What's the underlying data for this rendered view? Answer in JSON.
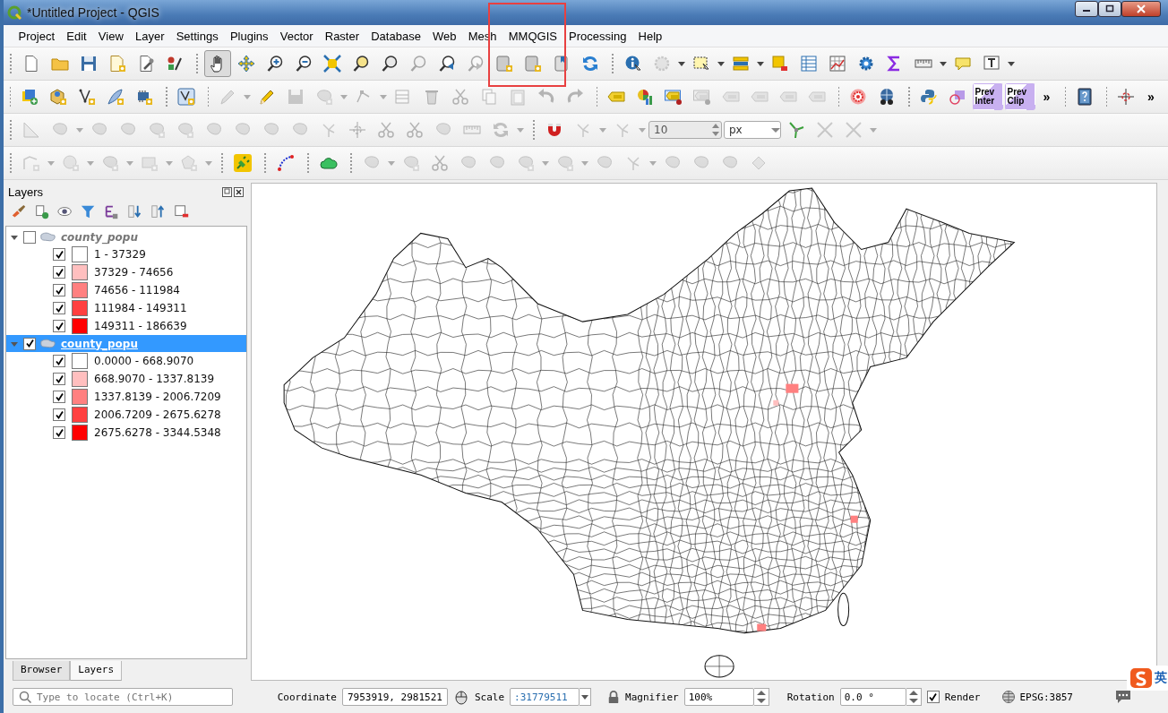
{
  "window": {
    "title": "*Untitled Project - QGIS"
  },
  "menu": [
    "Project",
    "Edit",
    "View",
    "Layer",
    "Settings",
    "Plugins",
    "Vector",
    "Raster",
    "Database",
    "Web",
    "Mesh",
    "MMQGIS",
    "Processing",
    "Help"
  ],
  "toolbars": [
    {
      "groups": [
        [
          {
            "kind": "new-project",
            "disabled": false,
            "selected": false
          },
          {
            "kind": "open-project",
            "disabled": false,
            "selected": false
          },
          {
            "kind": "save-project",
            "disabled": false,
            "selected": false
          },
          {
            "kind": "new-layout",
            "disabled": false,
            "selected": false
          },
          {
            "kind": "layout-manager",
            "disabled": false,
            "selected": false
          },
          {
            "kind": "style-manager",
            "disabled": false,
            "selected": false
          }
        ],
        [
          {
            "kind": "pan",
            "disabled": false,
            "selected": true
          },
          {
            "kind": "pan-to-selection",
            "disabled": false,
            "selected": false
          },
          {
            "kind": "zoom-in",
            "disabled": false,
            "selected": false
          },
          {
            "kind": "zoom-out",
            "disabled": false,
            "selected": false
          },
          {
            "kind": "zoom-full",
            "disabled": false,
            "selected": false
          },
          {
            "kind": "zoom-layer",
            "disabled": false,
            "selected": false
          },
          {
            "kind": "zoom-selection",
            "disabled": false,
            "selected": false
          },
          {
            "kind": "zoom-native",
            "disabled": true,
            "selected": false
          },
          {
            "kind": "zoom-last",
            "disabled": false,
            "selected": false
          },
          {
            "kind": "zoom-next",
            "disabled": true,
            "selected": false
          },
          {
            "kind": "map-sheet",
            "disabled": false,
            "selected": false
          },
          {
            "kind": "map-sheet",
            "disabled": false,
            "selected": false
          },
          {
            "kind": "bookmark",
            "disabled": false,
            "selected": false
          },
          {
            "kind": "refresh",
            "disabled": false,
            "selected": false
          }
        ],
        [
          {
            "kind": "identify",
            "disabled": false,
            "selected": false
          },
          {
            "kind": "pointer",
            "disabled": true,
            "selected": false
          },
          {
            "kind": "caret",
            "disabled": false,
            "selected": false
          },
          {
            "kind": "select",
            "disabled": false,
            "selected": false
          },
          {
            "kind": "caret",
            "disabled": false,
            "selected": false
          },
          {
            "kind": "select-value",
            "disabled": false,
            "selected": false
          },
          {
            "kind": "caret",
            "disabled": false,
            "selected": false
          },
          {
            "kind": "deselect",
            "disabled": false,
            "selected": false
          },
          {
            "kind": "attribute-table",
            "disabled": false,
            "selected": false
          },
          {
            "kind": "statistics",
            "disabled": false,
            "selected": false
          },
          {
            "kind": "toolbox",
            "disabled": false,
            "selected": false
          },
          {
            "kind": "sum",
            "disabled": false,
            "selected": false
          },
          {
            "kind": "measure",
            "disabled": false,
            "selected": false
          },
          {
            "kind": "caret",
            "disabled": false,
            "selected": false
          },
          {
            "kind": "map-tip",
            "disabled": false,
            "selected": false
          },
          {
            "kind": "text-annotation",
            "disabled": false,
            "selected": false
          },
          {
            "kind": "caret",
            "disabled": false,
            "selected": false
          }
        ]
      ]
    },
    {
      "groups": [
        [
          {
            "kind": "data-source",
            "disabled": false
          },
          {
            "kind": "new-geopackage",
            "disabled": false
          },
          {
            "kind": "new-shapefile",
            "disabled": false
          },
          {
            "kind": "new-temp",
            "disabled": false
          },
          {
            "kind": "virtual-layer",
            "disabled": false
          }
        ],
        [
          {
            "kind": "digitize-frame",
            "disabled": false
          }
        ],
        [
          {
            "kind": "current-edits",
            "disabled": true
          },
          {
            "kind": "caret",
            "disabled": true
          },
          {
            "kind": "toggle-edit",
            "disabled": false
          },
          {
            "kind": "save-edits",
            "disabled": true
          },
          {
            "kind": "shape-star",
            "disabled": true
          },
          {
            "kind": "caret",
            "disabled": true
          },
          {
            "kind": "vertex-tool",
            "disabled": true
          },
          {
            "kind": "caret",
            "disabled": true
          },
          {
            "kind": "modify-attributes",
            "disabled": true
          },
          {
            "kind": "delete",
            "disabled": true
          },
          {
            "kind": "cut",
            "disabled": true
          },
          {
            "kind": "copy",
            "disabled": true
          },
          {
            "kind": "paste",
            "disabled": true
          },
          {
            "kind": "undo",
            "disabled": true
          },
          {
            "kind": "redo",
            "disabled": true
          }
        ],
        [
          {
            "kind": "label",
            "disabled": false
          },
          {
            "kind": "diagram",
            "disabled": false
          },
          {
            "kind": "label-pin",
            "disabled": false
          },
          {
            "kind": "label-pin",
            "disabled": true
          },
          {
            "kind": "label",
            "disabled": true
          },
          {
            "kind": "label",
            "disabled": true
          },
          {
            "kind": "label",
            "disabled": true
          },
          {
            "kind": "label",
            "disabled": true
          }
        ],
        [
          {
            "kind": "target",
            "disabled": false
          },
          {
            "kind": "globe",
            "disabled": false
          }
        ],
        [
          {
            "kind": "python",
            "disabled": false
          },
          {
            "kind": "square-circle",
            "disabled": false
          },
          {
            "kind": "prev",
            "label": "Prev Inter",
            "disabled": false
          },
          {
            "kind": "prev",
            "label": "Prev Clip",
            "disabled": false
          },
          {
            "kind": "more",
            "label": "»",
            "disabled": false
          }
        ],
        [
          {
            "kind": "help",
            "disabled": false
          }
        ],
        [
          {
            "kind": "crosshair",
            "disabled": false
          },
          {
            "kind": "more",
            "label": "»",
            "disabled": false
          }
        ]
      ]
    },
    {
      "groups": [
        [
          {
            "kind": "measure-angle",
            "disabled": true
          },
          {
            "kind": "shape",
            "disabled": true
          },
          {
            "kind": "caret",
            "disabled": true
          },
          {
            "kind": "shape",
            "disabled": true
          },
          {
            "kind": "shape",
            "disabled": true
          },
          {
            "kind": "shape-star",
            "disabled": true
          },
          {
            "kind": "shape-star",
            "disabled": true
          },
          {
            "kind": "shape",
            "disabled": true
          },
          {
            "kind": "shape",
            "disabled": true
          },
          {
            "kind": "shape",
            "disabled": true
          },
          {
            "kind": "shape",
            "disabled": true
          },
          {
            "kind": "vertex-branch",
            "disabled": true
          },
          {
            "kind": "crosshair",
            "disabled": true
          },
          {
            "kind": "cut",
            "disabled": true
          },
          {
            "kind": "cut",
            "disabled": true
          },
          {
            "kind": "shape",
            "disabled": true
          },
          {
            "kind": "measure",
            "disabled": true
          },
          {
            "kind": "refresh",
            "disabled": true
          },
          {
            "kind": "caret",
            "disabled": true
          }
        ],
        [
          {
            "kind": "magnet",
            "disabled": false
          },
          {
            "kind": "vertex-branch",
            "disabled": true
          },
          {
            "kind": "caret",
            "disabled": true
          },
          {
            "kind": "vertex-branch",
            "disabled": true
          },
          {
            "kind": "caret",
            "disabled": true
          },
          {
            "kind": "spin",
            "value": "10",
            "disabled": true
          },
          {
            "kind": "combo",
            "value": "px",
            "disabled": false
          },
          {
            "kind": "tracing",
            "disabled": false
          },
          {
            "kind": "x-lines",
            "disabled": true
          },
          {
            "kind": "x-lines",
            "disabled": true
          },
          {
            "kind": "caret",
            "disabled": true
          }
        ]
      ]
    },
    {
      "groups": [
        [
          {
            "kind": "line-tool",
            "disabled": true
          },
          {
            "kind": "caret",
            "disabled": true
          },
          {
            "kind": "circle-tool",
            "disabled": true
          },
          {
            "kind": "caret",
            "disabled": true
          },
          {
            "kind": "shape-star",
            "disabled": true
          },
          {
            "kind": "caret",
            "disabled": true
          },
          {
            "kind": "rect-tool",
            "disabled": true
          },
          {
            "kind": "caret",
            "disabled": true
          },
          {
            "kind": "pentagon-tool",
            "disabled": true
          },
          {
            "kind": "caret",
            "disabled": true
          }
        ],
        [
          {
            "kind": "plug",
            "disabled": false
          }
        ],
        [
          {
            "kind": "curve",
            "disabled": false
          }
        ],
        [
          {
            "kind": "cloud",
            "disabled": false
          }
        ],
        [
          {
            "kind": "shape",
            "disabled": true
          },
          {
            "kind": "caret",
            "disabled": true
          },
          {
            "kind": "shape-star",
            "disabled": true
          },
          {
            "kind": "cut",
            "disabled": true
          },
          {
            "kind": "shape",
            "disabled": true
          },
          {
            "kind": "shape",
            "disabled": true
          },
          {
            "kind": "shape-star",
            "disabled": true
          },
          {
            "kind": "caret",
            "disabled": true
          },
          {
            "kind": "shape-star",
            "disabled": true
          },
          {
            "kind": "caret",
            "disabled": true
          },
          {
            "kind": "shape",
            "disabled": true
          },
          {
            "kind": "vertex-branch",
            "disabled": true
          },
          {
            "kind": "caret",
            "disabled": true
          },
          {
            "kind": "shape",
            "disabled": true
          },
          {
            "kind": "shape",
            "disabled": true
          },
          {
            "kind": "shape",
            "disabled": true
          },
          {
            "kind": "strip",
            "disabled": true
          }
        ]
      ]
    }
  ],
  "layers_panel": {
    "title": "Layers",
    "layers": [
      {
        "name": "county_popu",
        "checked": false,
        "expanded": true,
        "selected": false,
        "children": [
          {
            "label": "1 - 37329",
            "color": "#ffffff",
            "checked": true
          },
          {
            "label": "37329 - 74656",
            "color": "#ffbfbf",
            "checked": true
          },
          {
            "label": "74656 - 111984",
            "color": "#ff8080",
            "checked": true
          },
          {
            "label": "111984 - 149311",
            "color": "#ff4040",
            "checked": true
          },
          {
            "label": "149311 - 186639",
            "color": "#ff0000",
            "checked": true
          }
        ]
      },
      {
        "name": "county_popu",
        "checked": true,
        "expanded": true,
        "selected": true,
        "children": [
          {
            "label": "0.0000 - 668.9070",
            "color": "#ffffff",
            "checked": true
          },
          {
            "label": "668.9070 - 1337.8139",
            "color": "#ffbfbf",
            "checked": true
          },
          {
            "label": "1337.8139 - 2006.7209",
            "color": "#ff8080",
            "checked": true
          },
          {
            "label": "2006.7209 - 2675.6278",
            "color": "#ff4040",
            "checked": true
          },
          {
            "label": "2675.6278 - 3344.5348",
            "color": "#ff0000",
            "checked": true
          }
        ]
      }
    ],
    "tabs": [
      {
        "label": "Browser",
        "selected": false
      },
      {
        "label": "Layers",
        "selected": true
      }
    ]
  },
  "status_bar": {
    "locator": {
      "placeholder": "Type to locate (Ctrl+K)"
    },
    "coordinate_label": "Coordinate",
    "coordinate": "7953919, 2981521",
    "scale_label": "Scale",
    "scale": ":31779511",
    "magnifier_label": "Magnifier",
    "magnifier": "100%",
    "rotation_label": "Rotation",
    "rotation": "0.0 °",
    "render": {
      "label": "Render",
      "checked": true
    },
    "crs": "EPSG:3857"
  },
  "input_method": {
    "label": "英"
  }
}
